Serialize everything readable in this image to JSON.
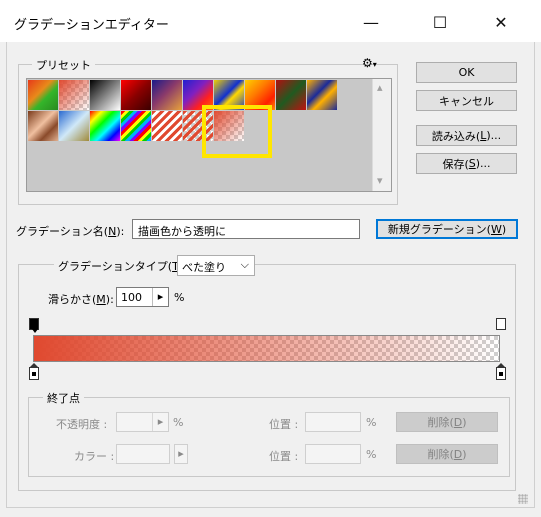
{
  "window": {
    "title": "グラデーションエディター",
    "minimize_glyph": "—",
    "maximize_glyph": "☐",
    "close_glyph": "✕"
  },
  "presets": {
    "label": "プリセット",
    "gear_glyph": "⚙",
    "gear_caret": "▾",
    "scroll_up": "▴",
    "scroll_down": "▾"
  },
  "buttons": {
    "ok": "OK",
    "cancel": "キャンセル",
    "load_pre": "読み込み(",
    "load_key": "L",
    "load_post": ")...",
    "save_pre": "保存(",
    "save_key": "S",
    "save_post": ")...",
    "new_pre": "新規グラデーション(",
    "new_key": "W",
    "new_post": ")"
  },
  "name_field": {
    "label_pre": "グラデーション名(",
    "label_key": "N",
    "label_post": "):",
    "value": "描画色から透明に"
  },
  "type_field": {
    "label_pre": "グラデーションタイプ(",
    "label_key": "T",
    "label_post": "):",
    "value": "べた塗り",
    "caret": "⌵"
  },
  "smoothness": {
    "label_pre": "滑らかさ(",
    "label_key": "M",
    "label_post": "):",
    "value": "100",
    "arrow": "▸",
    "unit": "%"
  },
  "gradient": {
    "start_color": "#e0492f",
    "end_color": "rgba(224,73,47,0)"
  },
  "stops_group": {
    "label": "終了点",
    "opacity_label": "不透明度 :",
    "opacity_unit": "%",
    "location_label": "位置 :",
    "location_unit": "%",
    "delete_pre": "削除(",
    "delete_key": "D",
    "delete_post": ")",
    "color_label": "カラー :",
    "arrow": "▸"
  },
  "selected_highlight_color": "#ffe600"
}
